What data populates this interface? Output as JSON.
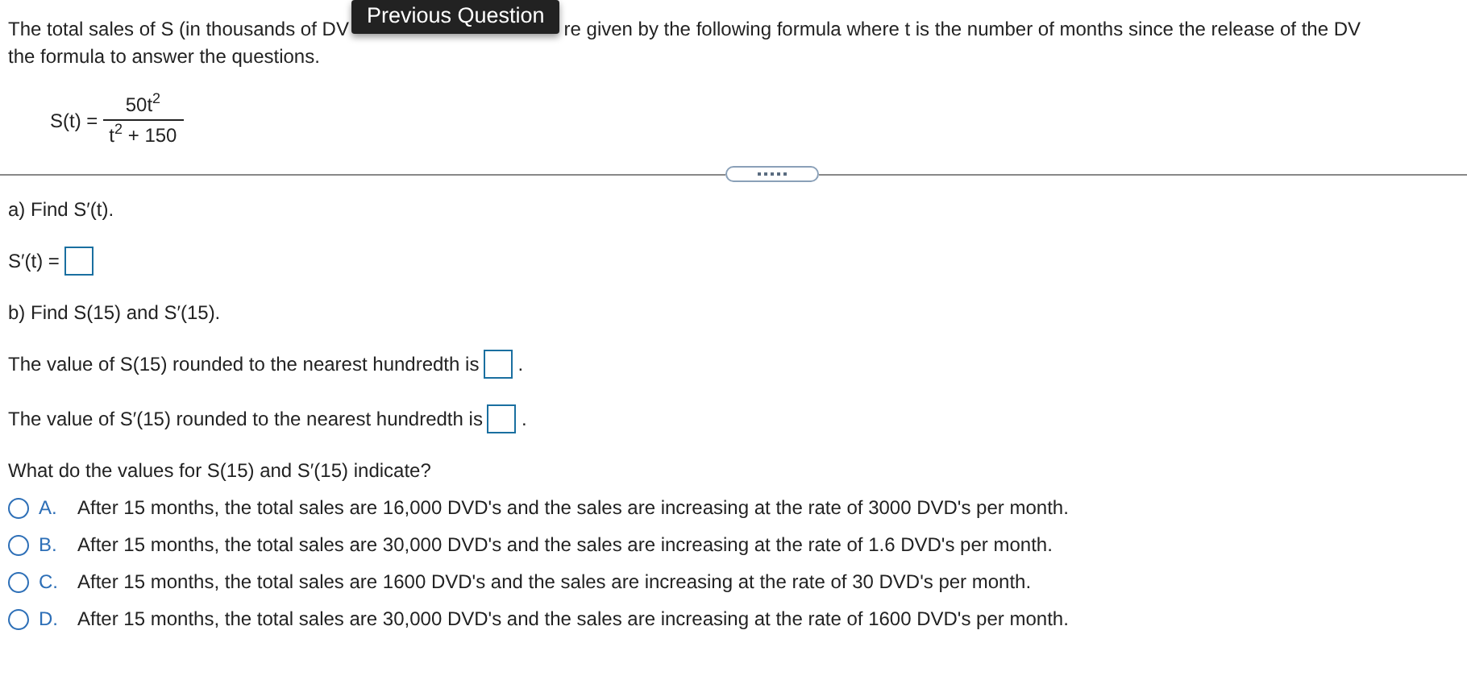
{
  "tooltip": {
    "label": "Previous Question"
  },
  "intro": {
    "line_1_start": "The total sales of S (in thousands of DV",
    "line_1_end": "re given by the following formula where t is the number of months since the release of the DV",
    "line_2": "the formula to answer the questions."
  },
  "formula": {
    "lhs": "S(t) =",
    "numerator": "50t$^{2}$",
    "denominator": "t$^{2}$ + 150"
  },
  "part_a": {
    "prompt": "a) Find S′(t).",
    "answer_label": "S′(t) ="
  },
  "part_b": {
    "prompt": "b) Find S(15) and S′(15).",
    "answers": [
      {
        "label": "The value of S(15) rounded to the nearest hundredth is",
        "suffix": "."
      },
      {
        "label": "The value of S′(15) rounded to the nearest hundredth is",
        "suffix": "."
      }
    ]
  },
  "part_c": {
    "prompt": "What do the values for S(15) and S′(15) indicate?",
    "options": [
      {
        "letter": "A.",
        "text": "After 15 months, the total sales are 16,000 DVD's and the sales are increasing at the rate of 3000 DVD's per month.",
        "selected": false
      },
      {
        "letter": "B.",
        "text": "After 15 months, the total sales are 30,000 DVD's and the sales are increasing at the rate of 1.6 DVD's per month.",
        "selected": false
      },
      {
        "letter": "C.",
        "text": "After 15 months, the total sales are 1600 DVD's and the sales are increasing at the rate of 30 DVD's per month.",
        "selected": false
      },
      {
        "letter": "D.",
        "text": "After 15 months, the total sales are 30,000 DVD's and the sales are increasing at the rate of 1600 DVD's per month.",
        "selected": false
      }
    ]
  }
}
